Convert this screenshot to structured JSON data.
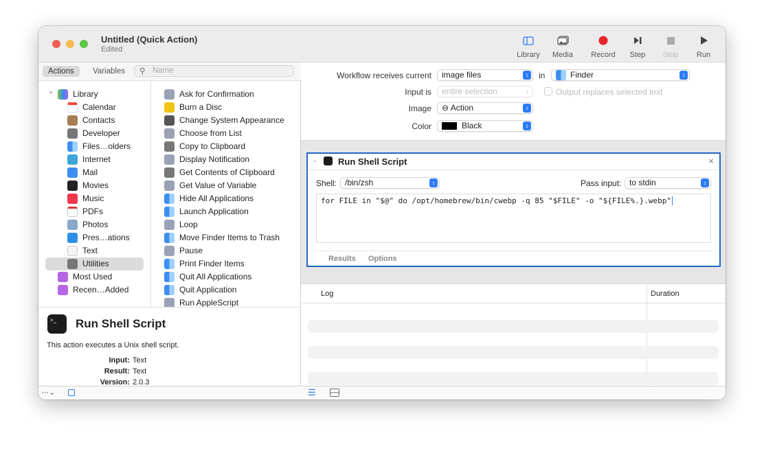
{
  "window": {
    "title": "Untitled (Quick Action)",
    "subtitle": "Edited"
  },
  "toolbar": {
    "buttons": [
      {
        "label": "Library",
        "icon": "sidebar-icon"
      },
      {
        "label": "Media",
        "icon": "photos-icon"
      },
      {
        "label": "Record",
        "icon": "record-icon"
      },
      {
        "label": "Step",
        "icon": "step-icon"
      },
      {
        "label": "Stop",
        "icon": "stop-icon"
      },
      {
        "label": "Run",
        "icon": "play-icon"
      }
    ]
  },
  "colors": {
    "accent": "#2566c4",
    "record": "#e8242b"
  },
  "library": {
    "tabs": [
      "Actions",
      "Variables"
    ],
    "search_placeholder": "Name",
    "categories": [
      {
        "label": "Library",
        "icon": "library-icon"
      },
      {
        "label": "Calendar",
        "icon": "calendar-icon"
      },
      {
        "label": "Contacts",
        "icon": "contacts-icon"
      },
      {
        "label": "Developer",
        "icon": "tools-icon"
      },
      {
        "label": "Files…olders",
        "icon": "finder-icon"
      },
      {
        "label": "Internet",
        "icon": "globe-icon"
      },
      {
        "label": "Mail",
        "icon": "mail-icon"
      },
      {
        "label": "Movies",
        "icon": "quicktime-icon"
      },
      {
        "label": "Music",
        "icon": "music-icon"
      },
      {
        "label": "PDFs",
        "icon": "pdf-icon"
      },
      {
        "label": "Photos",
        "icon": "photos-icon"
      },
      {
        "label": "Pres…ations",
        "icon": "keynote-icon"
      },
      {
        "label": "Text",
        "icon": "text-icon"
      },
      {
        "label": "Utilities",
        "icon": "tools-icon"
      },
      {
        "label": "Most Used",
        "icon": "smart-folder-icon"
      },
      {
        "label": "Recen…Added",
        "icon": "smart-folder-icon"
      }
    ],
    "selected_category": "Utilities",
    "actions": [
      {
        "label": "Ask for Confirmation",
        "icon": "automator-icon"
      },
      {
        "label": "Burn a Disc",
        "icon": "burn-icon"
      },
      {
        "label": "Change System Appearance",
        "icon": "system-icon"
      },
      {
        "label": "Choose from List",
        "icon": "automator-icon"
      },
      {
        "label": "Copy to Clipboard",
        "icon": "tools-icon"
      },
      {
        "label": "Display Notification",
        "icon": "automator-icon"
      },
      {
        "label": "Get Contents of Clipboard",
        "icon": "tools-icon"
      },
      {
        "label": "Get Value of Variable",
        "icon": "automator-icon"
      },
      {
        "label": "Hide All Applications",
        "icon": "finder-icon"
      },
      {
        "label": "Launch Application",
        "icon": "finder-icon"
      },
      {
        "label": "Loop",
        "icon": "automator-icon"
      },
      {
        "label": "Move Finder Items to Trash",
        "icon": "finder-icon"
      },
      {
        "label": "Pause",
        "icon": "automator-icon"
      },
      {
        "label": "Print Finder Items",
        "icon": "finder-icon"
      },
      {
        "label": "Quit All Applications",
        "icon": "finder-icon"
      },
      {
        "label": "Quit Application",
        "icon": "finder-icon"
      },
      {
        "label": "Run AppleScript",
        "icon": "automator-icon"
      }
    ]
  },
  "description": {
    "title": "Run Shell Script",
    "text": "This action executes a Unix shell script.",
    "fields": [
      {
        "label": "Input:",
        "value": "Text"
      },
      {
        "label": "Result:",
        "value": "Text"
      },
      {
        "label": "Version:",
        "value": "2.0.3"
      }
    ]
  },
  "workflow": {
    "receives_label": "Workflow receives current",
    "receives_value": "image files",
    "in_label": "in",
    "app_value": "Finder",
    "input_is_label": "Input is",
    "input_is_value": "entire selection",
    "output_replaces_label": "Output replaces selected text",
    "output_replaces_checked": false,
    "image_label": "Image",
    "image_value": "⊖ Action",
    "color_label": "Color",
    "color_value": "Black",
    "color_swatch": "#000000"
  },
  "action": {
    "title": "Run Shell Script",
    "shell_label": "Shell:",
    "shell_value": "/bin/zsh",
    "pass_input_label": "Pass input:",
    "pass_input_value": "to stdin",
    "script": "for FILE in \"$@\" do /opt/homebrew/bin/cwebp -q 85 \"$FILE\" -o \"${FILE%.}.webp\"",
    "tabs": [
      "Results",
      "Options"
    ]
  },
  "log": {
    "columns": [
      "Log",
      "Duration"
    ]
  }
}
